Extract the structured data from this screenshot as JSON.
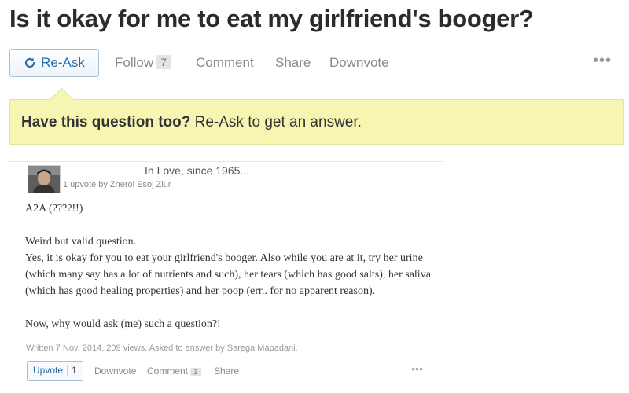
{
  "question": {
    "title": "Is it okay for me to eat my girlfriend's booger?"
  },
  "action_bar": {
    "reask_label": "Re-Ask",
    "follow_label": "Follow",
    "follow_count": "7",
    "comment_label": "Comment",
    "share_label": "Share",
    "downvote_label": "Downvote",
    "more_label": "•••"
  },
  "banner": {
    "bold_text": "Have this question too?",
    "rest_text": " Re-Ask to get an answer."
  },
  "answer": {
    "credential": "In Love, since 1965...",
    "upvote_note": "1 upvote by Znerol Esoj Ziur",
    "paragraphs": {
      "p1": "A2A (????!!)",
      "p2": "Weird but valid question.",
      "p3": "Yes, it is okay for you to eat your girlfriend's booger. Also while you are at it, try her urine (which many say has a lot of nutrients and such), her tears (which has good salts), her saliva (which has good healing properties) and her poop (err.. for no apparent reason).",
      "p4": "Now, why would ask (me) such a question?!"
    },
    "meta": "Written 7 Nov, 2014. 209 views. Asked to answer by Sarega Mapadani.",
    "actions": {
      "upvote_label": "Upvote",
      "upvote_count": "1",
      "downvote_label": "Downvote",
      "comment_label": "Comment",
      "comment_count": "1",
      "share_label": "Share",
      "more_label": "•••"
    }
  },
  "icons": {
    "reask": "refresh-icon",
    "avatar": "user-avatar"
  },
  "colors": {
    "link_blue": "#2b6dad",
    "banner_yellow": "#f6f6b2",
    "muted_gray": "#8a8a8a"
  }
}
